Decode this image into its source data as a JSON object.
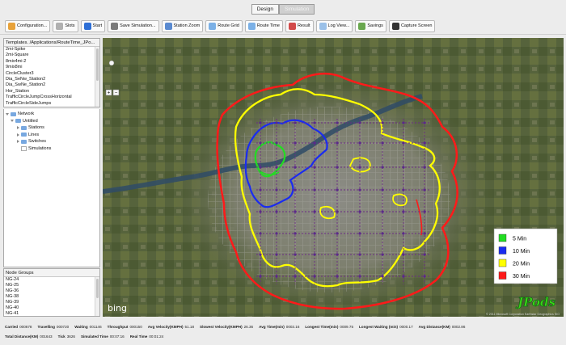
{
  "mode_tabs": [
    "Design",
    "Simulation"
  ],
  "toolbar": [
    {
      "label": "Configuration...",
      "icon": "gear-icon",
      "color": "#e8a23a"
    },
    {
      "label": "Slots",
      "icon": "slots-icon",
      "color": "#b0b0b0"
    },
    {
      "label": "Start",
      "icon": "play-icon",
      "color": "#2e6fd6"
    },
    {
      "label": "Save Simulation...",
      "icon": "save-icon",
      "color": "#7a7a7a"
    },
    {
      "label": "Station Zoom",
      "icon": "magnifier-icon",
      "color": "#5a8ad0"
    },
    {
      "label": "Route Grid",
      "icon": "route-grid-icon",
      "color": "#7bb0e6"
    },
    {
      "label": "Route Time",
      "icon": "route-time-icon",
      "color": "#7bb0e6"
    },
    {
      "label": "Result",
      "icon": "result-icon",
      "color": "#d24a4a"
    },
    {
      "label": "Log View...",
      "icon": "log-icon",
      "color": "#9ac0e8"
    },
    {
      "label": "Savings",
      "icon": "savings-icon",
      "color": "#6aa84f"
    },
    {
      "label": "Capture Screen",
      "icon": "camera-icon",
      "color": "#333333"
    }
  ],
  "templates": {
    "header": "Templates. /Applications/RouteTime_JPo...",
    "items": [
      "2mi-Spike",
      "2mi-Square",
      "8mix4mi-2",
      "9mix8mi",
      "CircleCluster3",
      "Dia_SeNw_Station2",
      "Dia_SwNe_Station2",
      "Hor_Station",
      "TrafficCircleJumpCrossHorizontal",
      "TrafficCircleSideJumps"
    ]
  },
  "network": {
    "root": "Network",
    "untitled": "Untitled",
    "children": [
      "Stations",
      "Lines",
      "Switches",
      "Simulations"
    ]
  },
  "node_groups": {
    "header": "Node Groups",
    "items": [
      "NG-24",
      "NG-25",
      "NG-36",
      "NG-38",
      "NG-39",
      "NG-40",
      "NG-41"
    ]
  },
  "map": {
    "provider": "bing",
    "copyright": "© 2011 Microsoft Corporation  Earthstar Geographics SIO",
    "watermark": "JPods",
    "zoom_in": "+",
    "zoom_out": "−",
    "legend": [
      {
        "label": "5 Min",
        "color": "#22dd22"
      },
      {
        "label": "10 Min",
        "color": "#1a2cf0"
      },
      {
        "label": "20 Min",
        "color": "#ffff00"
      },
      {
        "label": "30 Min",
        "color": "#ff1a1a"
      }
    ]
  },
  "status": {
    "row1": [
      {
        "label": "Carried",
        "value": "000678"
      },
      {
        "label": "Travelling",
        "value": "000720"
      },
      {
        "label": "Waiting",
        "value": "001146"
      },
      {
        "label": "Throughput",
        "value": "000150"
      },
      {
        "label": "Avg Velocity(KMPH)",
        "value": "51.18"
      },
      {
        "label": "Slowest Velocity(KMPH)",
        "value": "26.36"
      },
      {
        "label": "Avg Time(min)",
        "value": "0003.16"
      },
      {
        "label": "Longest Time(min)",
        "value": "0009.75"
      },
      {
        "label": "Longest Waiting (min)",
        "value": "0000.17"
      },
      {
        "label": "Avg Distance(KM)",
        "value": "0002.86"
      }
    ],
    "row2": [
      {
        "label": "Total Distance(KM)",
        "value": "001643"
      },
      {
        "label": "Tick",
        "value": "3626"
      },
      {
        "label": "Simulated Time",
        "value": "00:07:16"
      },
      {
        "label": "Real Time",
        "value": "00:01:24"
      }
    ]
  }
}
